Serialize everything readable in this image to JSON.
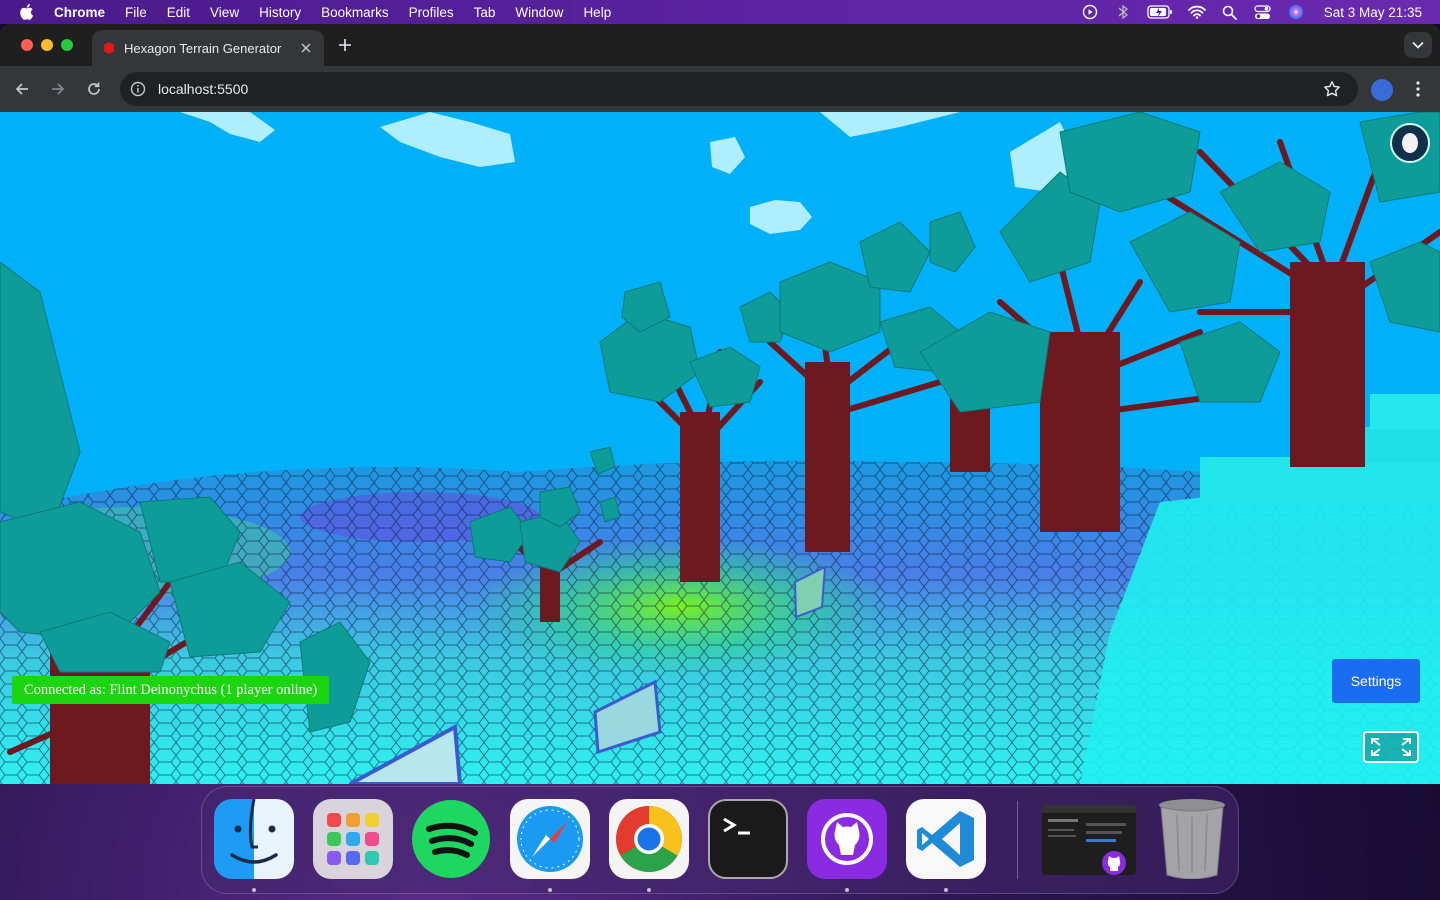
{
  "menubar": {
    "app_name": "Chrome",
    "items": [
      "File",
      "Edit",
      "View",
      "History",
      "Bookmarks",
      "Profiles",
      "Tab",
      "Window",
      "Help"
    ],
    "clock": "Sat 3 May  21:35"
  },
  "browser": {
    "tab_title": "Hexagon Terrain Generator",
    "url": "localhost:5500"
  },
  "game": {
    "connection_status": "Connected as: Flint Deinonychus (1 player online)",
    "settings_label": "Settings",
    "colors": {
      "sky": "#00b0f8",
      "foliage": "#0d9c98",
      "trunk": "#6e1820",
      "status_bg": "#1bd60f",
      "settings_bg": "#1a6cf0"
    }
  },
  "dock": {
    "apps": [
      "finder-icon",
      "launchpad-icon",
      "spotify-icon",
      "safari-icon",
      "chrome-icon",
      "terminal-icon",
      "github-desktop-icon",
      "vscode-icon",
      "window-preview",
      "trash-icon"
    ]
  }
}
